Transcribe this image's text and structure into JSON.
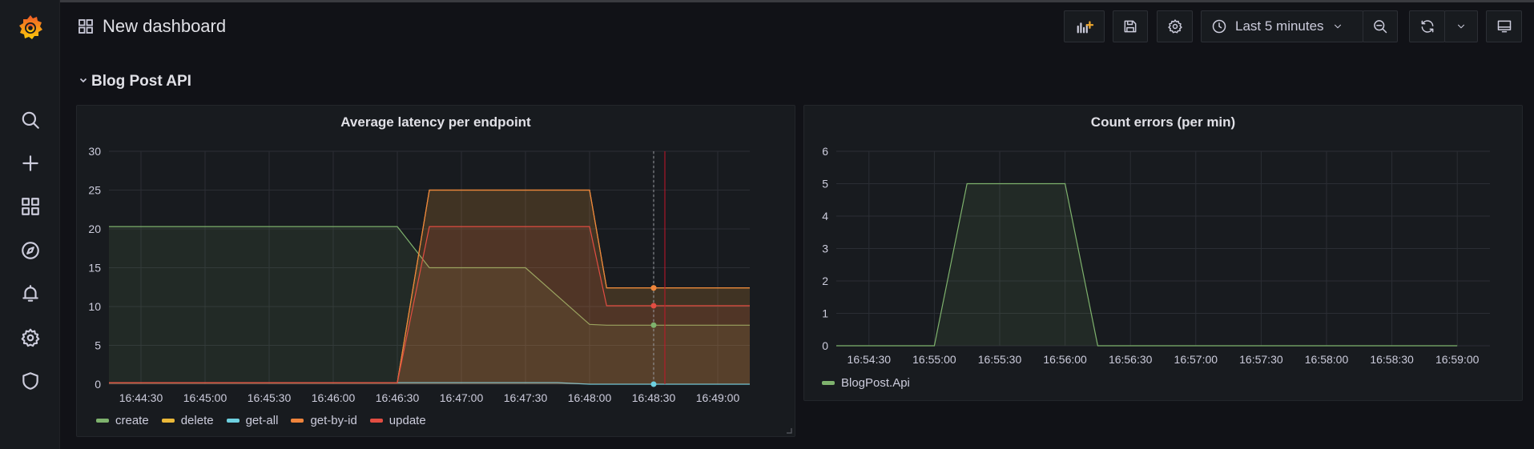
{
  "header": {
    "dashboard_title": "New dashboard",
    "time_range": "Last 5 minutes"
  },
  "sidemenu": {
    "items": [
      "search",
      "create",
      "dashboards",
      "explore",
      "alerting",
      "configuration",
      "server-admin"
    ]
  },
  "row": {
    "title": "Blog Post API"
  },
  "colors": {
    "create": "#7eb26d",
    "delete": "#eab839",
    "get-all": "#6ed0e0",
    "get-by-id": "#ef843c",
    "update": "#e24d42",
    "blogpost_api": "#7eb26d",
    "background": "#111217",
    "panel": "#181b1f"
  },
  "chart_data": [
    {
      "type": "area",
      "title": "Average latency per endpoint",
      "x": [
        "16:44:15",
        "16:46:30",
        "16:46:45",
        "16:47:30",
        "16:48:00",
        "16:48:08",
        "16:49:15"
      ],
      "x_ticks": [
        "16:44:30",
        "16:45:00",
        "16:45:30",
        "16:46:00",
        "16:46:30",
        "16:47:00",
        "16:47:30",
        "16:48:00",
        "16:48:30",
        "16:49:00"
      ],
      "y_ticks": [
        0,
        5,
        10,
        15,
        20,
        25,
        30
      ],
      "ylim": [
        0,
        30
      ],
      "grid": true,
      "legend_position": "bottom",
      "series": [
        {
          "name": "create",
          "x": [
            "16:44:15",
            "16:46:30",
            "16:46:45",
            "16:47:30",
            "16:48:00",
            "16:48:08",
            "16:49:15"
          ],
          "values": [
            20.3,
            20.3,
            15,
            15,
            7.7,
            7.6,
            7.6
          ]
        },
        {
          "name": "delete",
          "x": [
            "16:44:15",
            "16:46:30",
            "16:46:45",
            "16:48:00",
            "16:48:08",
            "16:49:15"
          ],
          "values": [
            0.2,
            0.2,
            25,
            25,
            12.4,
            12.4
          ]
        },
        {
          "name": "get-all",
          "x": [
            "16:44:15",
            "16:47:45",
            "16:48:00",
            "16:49:15"
          ],
          "values": [
            0.2,
            0.2,
            0,
            0
          ]
        },
        {
          "name": "get-by-id",
          "x": [
            "16:44:15",
            "16:46:30",
            "16:46:45",
            "16:48:00",
            "16:48:08",
            "16:49:15"
          ],
          "values": [
            0.2,
            0.2,
            25,
            25,
            12.4,
            12.4
          ]
        },
        {
          "name": "update",
          "x": [
            "16:44:15",
            "16:46:30",
            "16:46:45",
            "16:48:00",
            "16:48:08",
            "16:49:15"
          ],
          "values": [
            0.2,
            0.2,
            20.3,
            20.3,
            10.1,
            10.1
          ]
        }
      ],
      "cursor_time": "16:48:30"
    },
    {
      "type": "area",
      "title": "Count errors (per min)",
      "x_ticks": [
        "16:54:30",
        "16:55:00",
        "16:55:30",
        "16:56:00",
        "16:56:30",
        "16:57:00",
        "16:57:30",
        "16:58:00",
        "16:58:30",
        "16:59:00"
      ],
      "y_ticks": [
        0,
        1,
        2,
        3,
        4,
        5,
        6
      ],
      "ylim": [
        0,
        6
      ],
      "grid": true,
      "legend_position": "bottom",
      "series": [
        {
          "name": "BlogPost.Api",
          "x": [
            "16:54:15",
            "16:55:00",
            "16:55:15",
            "16:56:00",
            "16:56:15",
            "16:59:00"
          ],
          "values": [
            0,
            0,
            5,
            5,
            0,
            0
          ]
        }
      ]
    }
  ]
}
